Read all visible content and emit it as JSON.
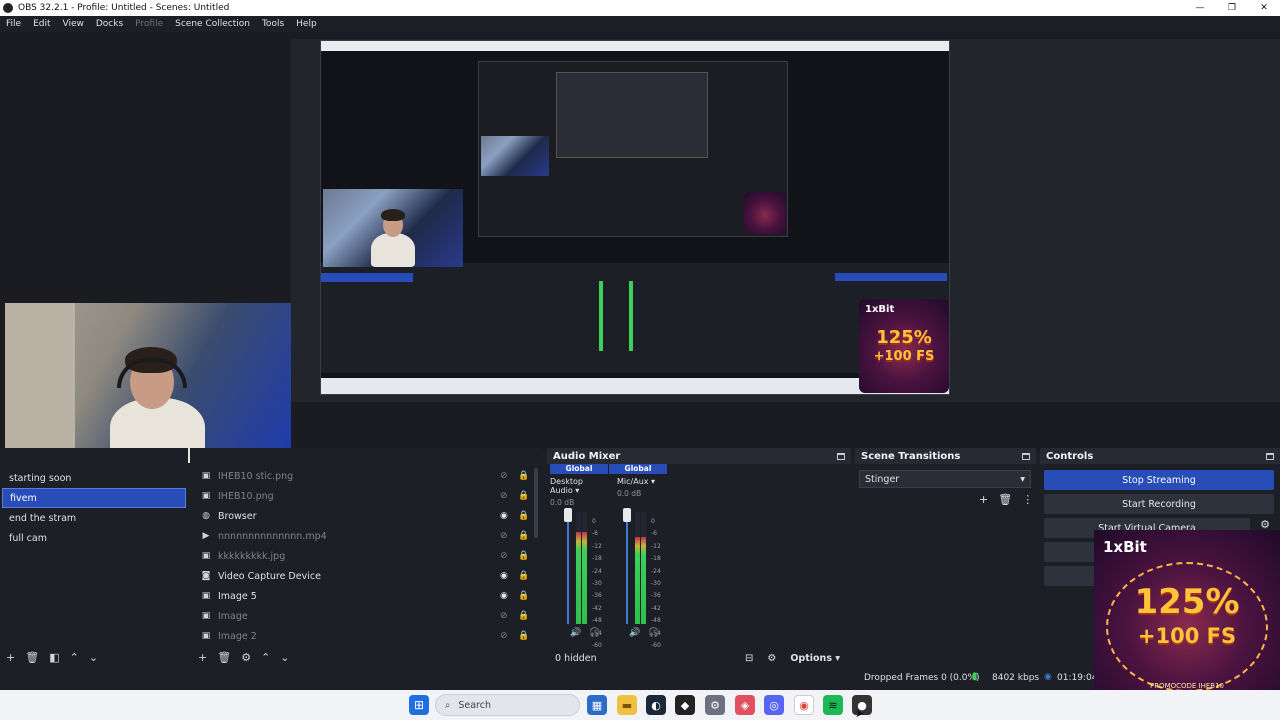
{
  "window": {
    "title": "OBS 32.2.1 - Profile: Untitled - Scenes: Untitled"
  },
  "menu": [
    "File",
    "Edit",
    "View",
    "Docks",
    "Profile",
    "Scene Collection",
    "Tools",
    "Help"
  ],
  "scenes": {
    "items": [
      {
        "label": "starting soon",
        "selected": false
      },
      {
        "label": "fivem",
        "selected": true
      },
      {
        "label": "end the stram",
        "selected": false
      },
      {
        "label": "full cam",
        "selected": false
      }
    ]
  },
  "sources": {
    "items": [
      {
        "label": "IHEB10 stic.png",
        "icon": "image-icon",
        "visible": false
      },
      {
        "label": "IHEB10.png",
        "icon": "image-icon",
        "visible": false
      },
      {
        "label": "Browser",
        "icon": "browser-icon",
        "visible": true
      },
      {
        "label": "nnnnnnnnnnnnnn.mp4",
        "icon": "media-icon",
        "visible": false
      },
      {
        "label": "kkkkkkkkk.jpg",
        "icon": "image-icon",
        "visible": false
      },
      {
        "label": "Video Capture Device",
        "icon": "camera-icon",
        "visible": true
      },
      {
        "label": "Image 5",
        "icon": "image-icon",
        "visible": true
      },
      {
        "label": "Image",
        "icon": "image-icon",
        "visible": false
      },
      {
        "label": "Image 2",
        "icon": "image-icon",
        "visible": false
      }
    ]
  },
  "audio_mixer": {
    "title": "Audio Mixer",
    "channels": [
      {
        "global": "Global",
        "name": "Desktop Audio",
        "db": "0.0 dB",
        "level": 0.82
      },
      {
        "global": "Global",
        "name": "Mic/Aux",
        "db": "0.0 dB",
        "level": 0.78
      }
    ],
    "scale": [
      "0",
      "-6",
      "-12",
      "-18",
      "-24",
      "-30",
      "-36",
      "-42",
      "-48",
      "-54",
      "-60"
    ],
    "hidden": "0 hidden",
    "options": "Options"
  },
  "transitions": {
    "title": "Scene Transitions",
    "selected": "Stinger"
  },
  "controls": {
    "title": "Controls",
    "stop_streaming": "Stop Streaming",
    "start_recording": "Start Recording",
    "start_virtual_camera": "Start Virtual Camera"
  },
  "status": {
    "dropped_frames": "Dropped Frames 0 (0.0%)",
    "bitrate": "8402 kbps",
    "time": "01:19:04"
  },
  "promo": {
    "brand": "1xBit",
    "headline1": "125%",
    "headline2": "+100 FS",
    "code": "PROMOCODE IHEB10"
  },
  "taskbar": {
    "search_placeholder": "Search"
  },
  "colors": {
    "accent": "#284cb8",
    "background": "#1d1f26",
    "meter_green": "#3ccf5a",
    "meter_red": "#c0334a"
  }
}
